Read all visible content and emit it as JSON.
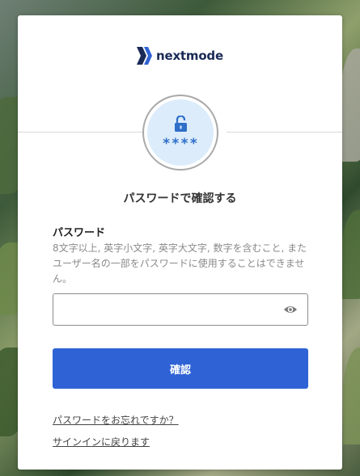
{
  "brand": {
    "name": "nextmode",
    "color": "#1a2a57",
    "mark_icon": "nextmode-x-logo-icon"
  },
  "badge": {
    "icon": "unlocked-padlock-icon",
    "masked_text": "****",
    "accent": "#2f6fc9",
    "background": "#dcecfb"
  },
  "page": {
    "title": "パスワードで確認する"
  },
  "password_field": {
    "label": "パスワード",
    "hint": "8文字以上, 英字小文字, 英字大文字, 数字を含むこと, またユーザー名の一部をパスワードに使用することはできません。",
    "value": "",
    "placeholder": "",
    "toggle_icon": "eye-icon"
  },
  "actions": {
    "confirm_label": "確認",
    "confirm_color": "#2f63d5"
  },
  "links": {
    "forgot_password": "パスワードをお忘れですか？",
    "back_to_signin": "サインインに戻ります"
  }
}
